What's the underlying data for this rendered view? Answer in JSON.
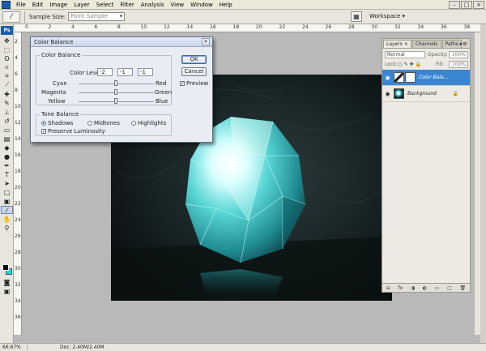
{
  "menu": {
    "items": [
      "File",
      "Edit",
      "Image",
      "Layer",
      "Select",
      "Filter",
      "Analysis",
      "View",
      "Window",
      "Help"
    ]
  },
  "window_controls": [
    "–",
    "□",
    "×"
  ],
  "options_bar": {
    "sample_size_label": "Sample Size:",
    "sample_size_value": "Point Sample",
    "workspace_label": "Workspace ▾"
  },
  "toolbox": {
    "badge": "Ps",
    "tools": [
      {
        "name": "move-tool-icon",
        "glyph": "✥"
      },
      {
        "name": "marquee-tool-icon",
        "glyph": "⬚"
      },
      {
        "name": "lasso-tool-icon",
        "glyph": "ʘ"
      },
      {
        "name": "magic-wand-tool-icon",
        "glyph": "✧"
      },
      {
        "name": "crop-tool-icon",
        "glyph": "⌗"
      },
      {
        "name": "slice-tool-icon",
        "glyph": "⟋"
      },
      {
        "name": "healing-brush-icon",
        "glyph": "✚"
      },
      {
        "name": "brush-tool-icon",
        "glyph": "✎"
      },
      {
        "name": "clone-stamp-icon",
        "glyph": "⊥"
      },
      {
        "name": "history-brush-icon",
        "glyph": "↺"
      },
      {
        "name": "eraser-tool-icon",
        "glyph": "▭"
      },
      {
        "name": "gradient-tool-icon",
        "glyph": "▤"
      },
      {
        "name": "blur-tool-icon",
        "glyph": "◆"
      },
      {
        "name": "dodge-tool-icon",
        "glyph": "●"
      },
      {
        "name": "pen-tool-icon",
        "glyph": "✒"
      },
      {
        "name": "type-tool-icon",
        "glyph": "T"
      },
      {
        "name": "path-selection-icon",
        "glyph": "➤"
      },
      {
        "name": "shape-tool-icon",
        "glyph": "▢"
      },
      {
        "name": "notes-tool-icon",
        "glyph": "▣"
      },
      {
        "name": "eyedropper-tool-icon",
        "glyph": "⁄"
      },
      {
        "name": "hand-tool-icon",
        "glyph": "✋"
      },
      {
        "name": "zoom-tool-icon",
        "glyph": "⚲"
      }
    ],
    "extra": [
      {
        "name": "quick-mask-icon",
        "glyph": "◙"
      },
      {
        "name": "screen-mode-icon",
        "glyph": "▣"
      }
    ]
  },
  "rulers": {
    "top": [
      "0",
      "2",
      "4",
      "6",
      "8",
      "10",
      "12",
      "14",
      "16",
      "18",
      "20",
      "22",
      "24",
      "26",
      "28",
      "30",
      "32",
      "34",
      "36",
      "38"
    ],
    "left": [
      "2",
      "4",
      "6",
      "8",
      "10",
      "12",
      "14",
      "16",
      "18",
      "20",
      "22",
      "24",
      "26",
      "28",
      "30",
      "32",
      "34",
      "36"
    ]
  },
  "dialog": {
    "title": "Color Balance",
    "color_balance_legend": "Color Balance",
    "color_levels_label": "Color Levels:",
    "levels": [
      "-2",
      "-1",
      "-1"
    ],
    "sliders": [
      {
        "left": "Cyan",
        "right": "Red",
        "value": -2
      },
      {
        "left": "Magenta",
        "right": "Green",
        "value": -1
      },
      {
        "left": "Yellow",
        "right": "Blue",
        "value": -1
      }
    ],
    "tone_legend": "Tone Balance",
    "tones": [
      "Shadows",
      "Midtones",
      "Highlights"
    ],
    "selected_tone": "Shadows",
    "preserve_luminosity": "Preserve Luminosity",
    "ok": "OK",
    "cancel": "Cancel",
    "preview": "Preview"
  },
  "layers_panel": {
    "tabs": [
      "Layers ×",
      "Channels",
      "Paths"
    ],
    "menu_glyph": "▸≡",
    "blend_mode": "Normal",
    "opacity_label": "Opacity:",
    "opacity_value": "100%",
    "lock_label": "Lock:",
    "fill_label": "Fill:",
    "fill_value": "100%",
    "layers": [
      {
        "name": "Color Bala...",
        "selected": true
      },
      {
        "name": "Background",
        "selected": false
      }
    ],
    "bottom_icons": [
      "⊖",
      "fx",
      "◑",
      "◐",
      "▭",
      "▢",
      "🗑"
    ]
  },
  "status": {
    "zoom": "66.67%",
    "doc": "Doc: 2.40M/2.40M"
  },
  "colors": {
    "foreground": "#000000",
    "background": "#1bd7e6",
    "selected_layer": "#3a86d3",
    "canvas": "#101819"
  }
}
